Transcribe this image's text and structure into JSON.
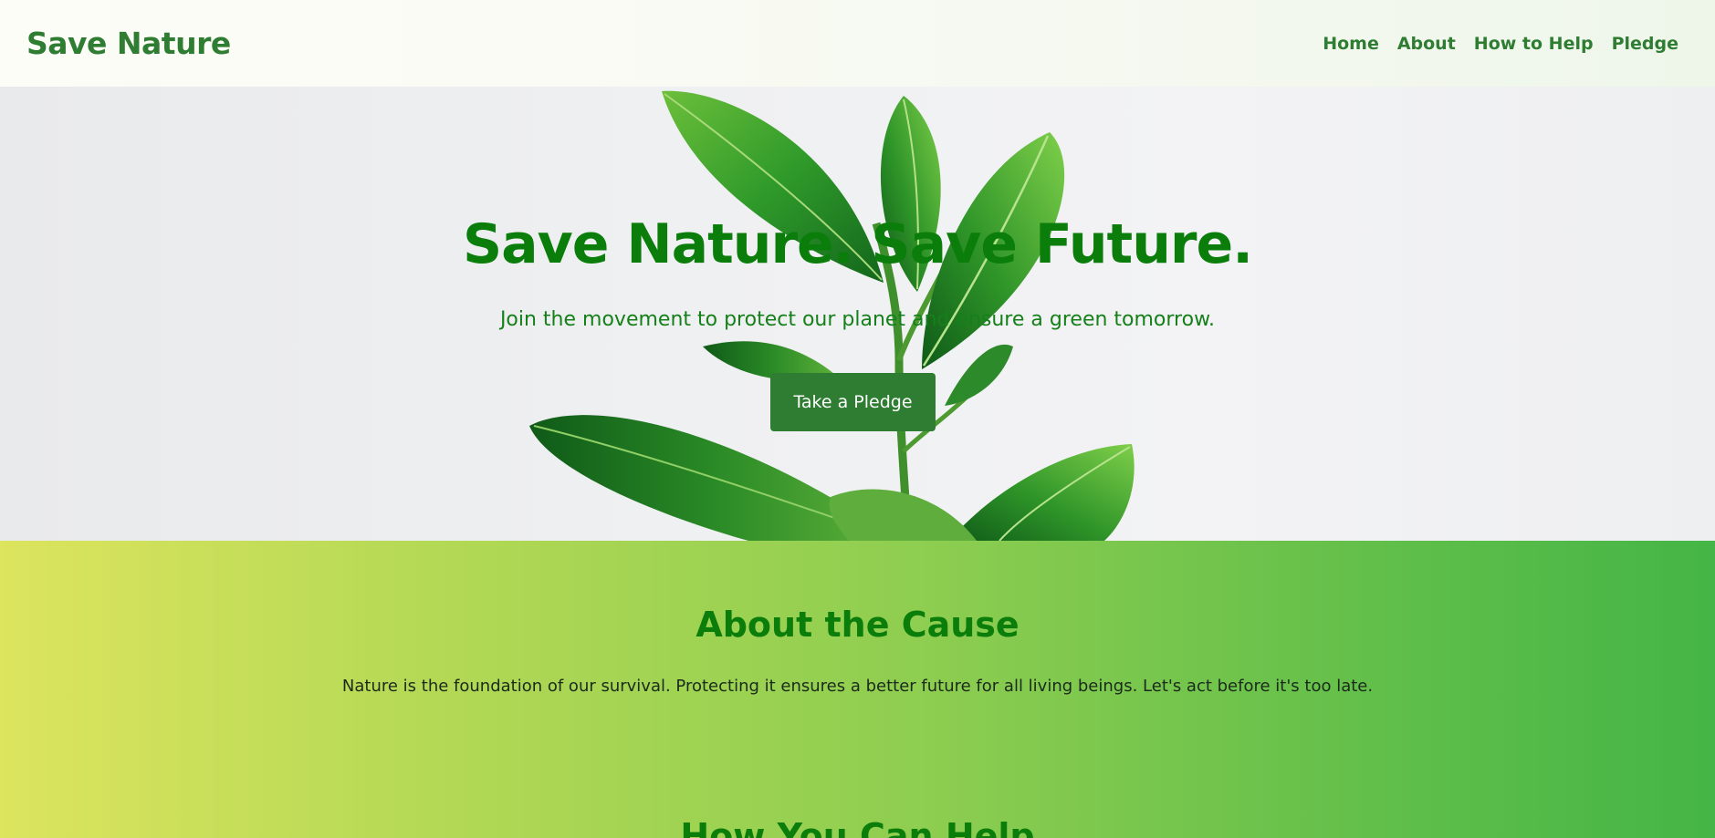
{
  "nav": {
    "brand": "Save Nature",
    "links": [
      "Home",
      "About",
      "How to Help",
      "Pledge"
    ]
  },
  "hero": {
    "title": "Save Nature. Save Future.",
    "subtitle": "Join the movement to protect our planet and ensure a green tomorrow.",
    "cta_label": "Take a Pledge"
  },
  "about": {
    "title": "About the Cause",
    "text": "Nature is the foundation of our survival. Protecting it ensures a better future for all living beings. Let's act before it's too late."
  },
  "help": {
    "title": "How You Can Help"
  },
  "colors": {
    "brand_green": "#2e7d32",
    "heading_green": "#0a7d0a",
    "gradient_start": "#dde45e",
    "gradient_end": "#44b546"
  }
}
